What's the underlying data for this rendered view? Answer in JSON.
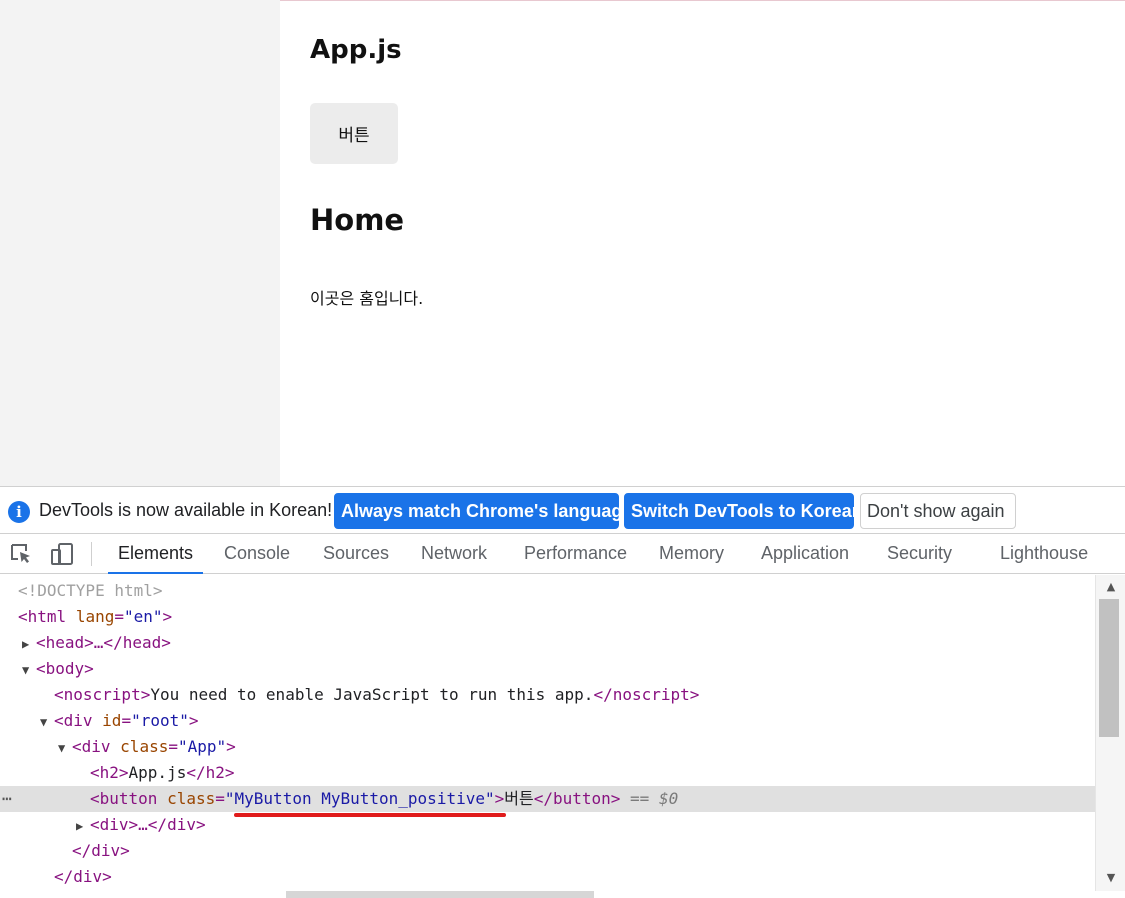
{
  "page": {
    "heading": "App.js",
    "button_label": "버튼",
    "subheading": "Home",
    "paragraph": "이곳은 홈입니다."
  },
  "infobar": {
    "icon": "info-icon",
    "message": "DevTools is now available in Korean!",
    "btn_match": "Always match Chrome's language",
    "btn_switch": "Switch DevTools to Korean",
    "btn_dismiss": "Don't show again"
  },
  "tabs": [
    "Elements",
    "Console",
    "Sources",
    "Network",
    "Performance",
    "Memory",
    "Application",
    "Security",
    "Lighthouse"
  ],
  "active_tab": "Elements",
  "dom": {
    "doctype": "<!DOCTYPE html>",
    "html_open": "<html",
    "html_lang_attr": "lang",
    "html_lang_val": "\"en\"",
    "head": "<head>…</head>",
    "body_open": "<body>",
    "noscript_open": "<noscript>",
    "noscript_text": "You need to enable JavaScript to run this app.",
    "noscript_close": "</noscript>",
    "div_root_open": "<div",
    "id_attr": "id",
    "root_val": "\"root\"",
    "div_app_open": "<div",
    "class_attr": "class",
    "app_val": "\"App\"",
    "h2_open": "<h2>",
    "h2_text": "App.js",
    "h2_close": "</h2>",
    "button_open": "<button",
    "button_class_attr": "class",
    "button_class_val": "\"MyButton MyButton_positive\"",
    "button_text": "버튼",
    "button_close": "</button>",
    "selected_marker": "== $0",
    "div_collapsed": "<div>…</div>",
    "div_close": "</div>",
    "div_close2": "</div>",
    "ellipsis": "⋯"
  },
  "colors": {
    "accent": "#1a73e8",
    "tag": "#881280",
    "attr": "#994500",
    "value": "#1a1aa6",
    "annotation": "#e01b1b"
  }
}
